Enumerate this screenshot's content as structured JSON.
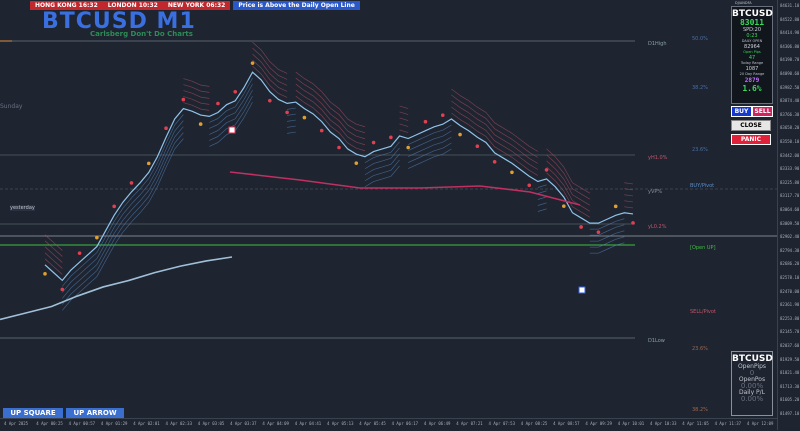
{
  "header": {
    "clocks": [
      "HONG KONG 16:32",
      "LONDON 10:32",
      "NEW YORK 06:32"
    ],
    "alert": "Price is Above the Daily Open Line",
    "title": "BTCUSD M1",
    "subtitle": "Carlsberg Don't Do Charts",
    "account": "DJ/ANDFA"
  },
  "sunday_label": "Sunday",
  "panel": {
    "symbol": "BTCUSD",
    "price": "83011",
    "spread": "SPD:20",
    "timer": "0:23",
    "daily_open_label": "DAILY OPEN",
    "daily_open": "82964",
    "open_pips_label": "Open Pips",
    "open_pips": "47",
    "today_range_label": "Today Range",
    "today_range": "1087",
    "day_range_label": "20 Day Range",
    "day_range": "2879",
    "pct": "1.6%"
  },
  "buttons": {
    "buy": "BUY",
    "sell": "SELL",
    "close": "CLOSE",
    "panic": "PANIC"
  },
  "positions": {
    "symbol": "BTCUSD",
    "open_pips_label": "OpenPips",
    "open_pips": "0",
    "open_pos_label": "OpenPos",
    "open_pos": "0.00%",
    "daily_pl_label": "Daily P/L",
    "daily_pl": "0.00%"
  },
  "bottom_buttons": [
    "UP SQUARE",
    "UP ARROW"
  ],
  "levels": {
    "d1high": "D1High",
    "yh": "yH1.0%",
    "yvp": "yVP%",
    "buy_pivot": "BUY/Pivot",
    "yl": "yL0.2%",
    "open_up": "[Open UP]",
    "sell_pivot": "SELL/Pivot",
    "d1low": "D1Low",
    "yesterday": "yesterday"
  },
  "percent_labels": [
    "50.0%",
    "38.2%",
    "23.6%",
    "23.6%",
    "38.2%"
  ],
  "price_axis": [
    "84631.10",
    "84522.80",
    "84414.90",
    "84306.80",
    "84198.70",
    "84090.60",
    "83982.50",
    "83874.40",
    "83766.30",
    "83658.20",
    "83550.10",
    "83442.00",
    "83333.90",
    "83225.80",
    "83117.70",
    "83064.60",
    "83009.50",
    "82902.40",
    "82794.30",
    "82686.20",
    "82578.10",
    "82470.00",
    "82361.90",
    "82253.80",
    "82145.70",
    "82037.60",
    "81929.50",
    "81821.40",
    "81713.30",
    "81605.20",
    "81497.10"
  ],
  "time_axis": [
    "4 Apr 2025",
    "4 Apr 00:25",
    "4 Apr 00:57",
    "4 Apr 01:29",
    "4 Apr 02:01",
    "4 Apr 02:33",
    "4 Apr 03:05",
    "4 Apr 03:37",
    "4 Apr 04:09",
    "4 Apr 04:41",
    "4 Apr 05:13",
    "4 Apr 05:45",
    "4 Apr 06:17",
    "4 Apr 06:49",
    "4 Apr 07:21",
    "4 Apr 07:53",
    "4 Apr 08:25",
    "4 Apr 08:57",
    "4 Apr 09:29",
    "4 Apr 10:01",
    "4 Apr 10:33",
    "4 Apr 11:05",
    "4 Apr 11:37",
    "4 Apr 12:09"
  ],
  "colors": {
    "bg": "#1e2430",
    "upper_band": "#5b8fc9",
    "lower_band": "#c2566a",
    "ma": "#c03060",
    "slow_ma": "#a0c0d8",
    "open_line": "#3fbf3f"
  },
  "chart_data": {
    "type": "line",
    "series": [
      {
        "values": [
          82620,
          82560,
          82500,
          82580,
          82640,
          82700,
          82760,
          82880,
          83000,
          83100,
          83180,
          83250,
          83330,
          83450,
          83600,
          83740,
          83820,
          83800,
          83770,
          83760,
          83790,
          83850,
          83880,
          83980,
          84100,
          84040,
          83950,
          83890,
          83860,
          83870,
          83820,
          83780,
          83720,
          83640,
          83590,
          83510,
          83470,
          83450,
          83490,
          83510,
          83530,
          83610,
          83590,
          83620,
          83650,
          83680,
          83700,
          83740,
          83690,
          83650,
          83600,
          83560,
          83480,
          83440,
          83400,
          83350,
          83300,
          83260,
          83280,
          83220,
          83140,
          83020,
          82980,
          82940,
          82940,
          82970,
          83000,
          83020,
          83011
        ]
      },
      {
        "values": [
          82200,
          82250,
          82300,
          82380,
          82450,
          82500,
          82560,
          82610,
          82650,
          82680
        ]
      }
    ]
  }
}
